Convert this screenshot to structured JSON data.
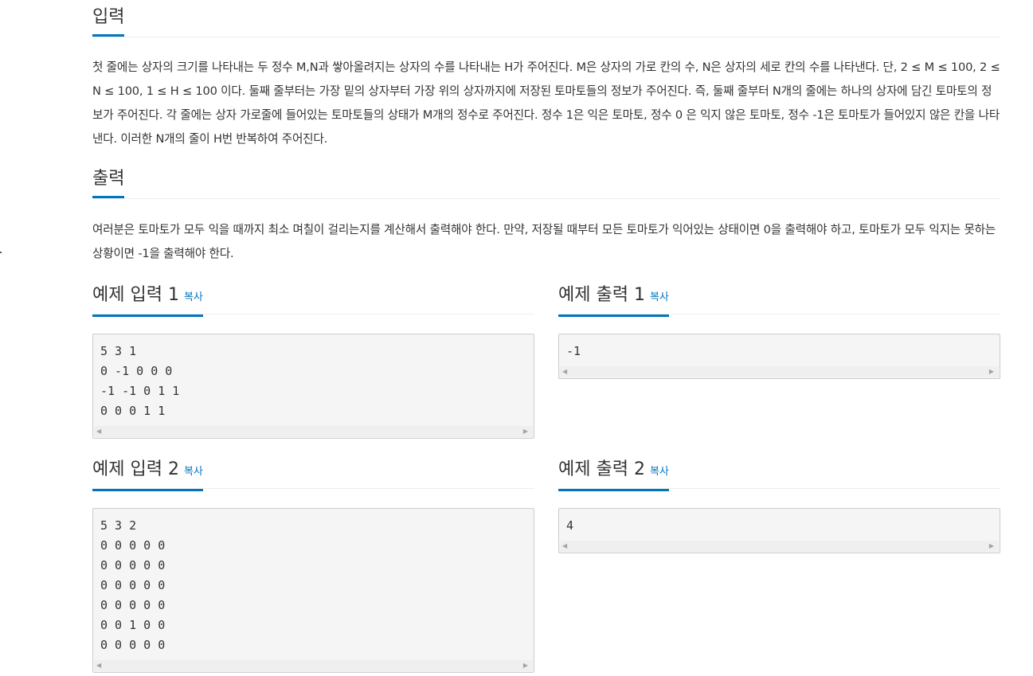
{
  "input_section": {
    "title": "입력",
    "text": "첫 줄에는 상자의 크기를 나타내는 두 정수 M,N과 쌓아올려지는 상자의 수를 나타내는 H가 주어진다. M은 상자의 가로 칸의 수, N은 상자의 세로 칸의 수를 나타낸다. 단, 2 ≤ M ≤ 100, 2 ≤ N ≤ 100, 1 ≤ H ≤ 100 이다. 둘째 줄부터는 가장 밑의 상자부터 가장 위의 상자까지에 저장된 토마토들의 정보가 주어진다. 즉, 둘째 줄부터 N개의 줄에는 하나의 상자에 담긴 토마토의 정보가 주어진다. 각 줄에는 상자 가로줄에 들어있는 토마토들의 상태가 M개의 정수로 주어진다. 정수 1은 익은 토마토, 정수 0 은 익지 않은 토마토, 정수 -1은 토마토가 들어있지 않은 칸을 나타낸다. 이러한 N개의 줄이 H번 반복하여 주어진다."
  },
  "output_section": {
    "title": "출력",
    "text": "여러분은 토마토가 모두 익을 때까지 최소 며칠이 걸리는지를 계산해서 출력해야 한다. 만약, 저장될 때부터 모든 토마토가 익어있는 상태이면 0을 출력해야 하고, 토마토가 모두 익지는 못하는 상황이면 -1을 출력해야 한다."
  },
  "copy_label": "복사",
  "examples": [
    {
      "input_title": "예제 입력 1",
      "input_text": "5 3 1\n0 -1 0 0 0\n-1 -1 0 1 1\n0 0 0 1 1",
      "output_title": "예제 출력 1",
      "output_text": "-1"
    },
    {
      "input_title": "예제 입력 2",
      "input_text": "5 3 2\n0 0 0 0 0\n0 0 0 0 0\n0 0 0 0 0\n0 0 0 0 0\n0 0 1 0 0\n0 0 0 0 0",
      "output_title": "예제 출력 2",
      "output_text": "4"
    }
  ],
  "icons": {
    "scroll_left": "scroll-left-arrow-icon",
    "scroll_right": "scroll-right-arrow-icon"
  },
  "colors": {
    "accent": "#0076c0",
    "code_bg": "#f5f5f5"
  }
}
